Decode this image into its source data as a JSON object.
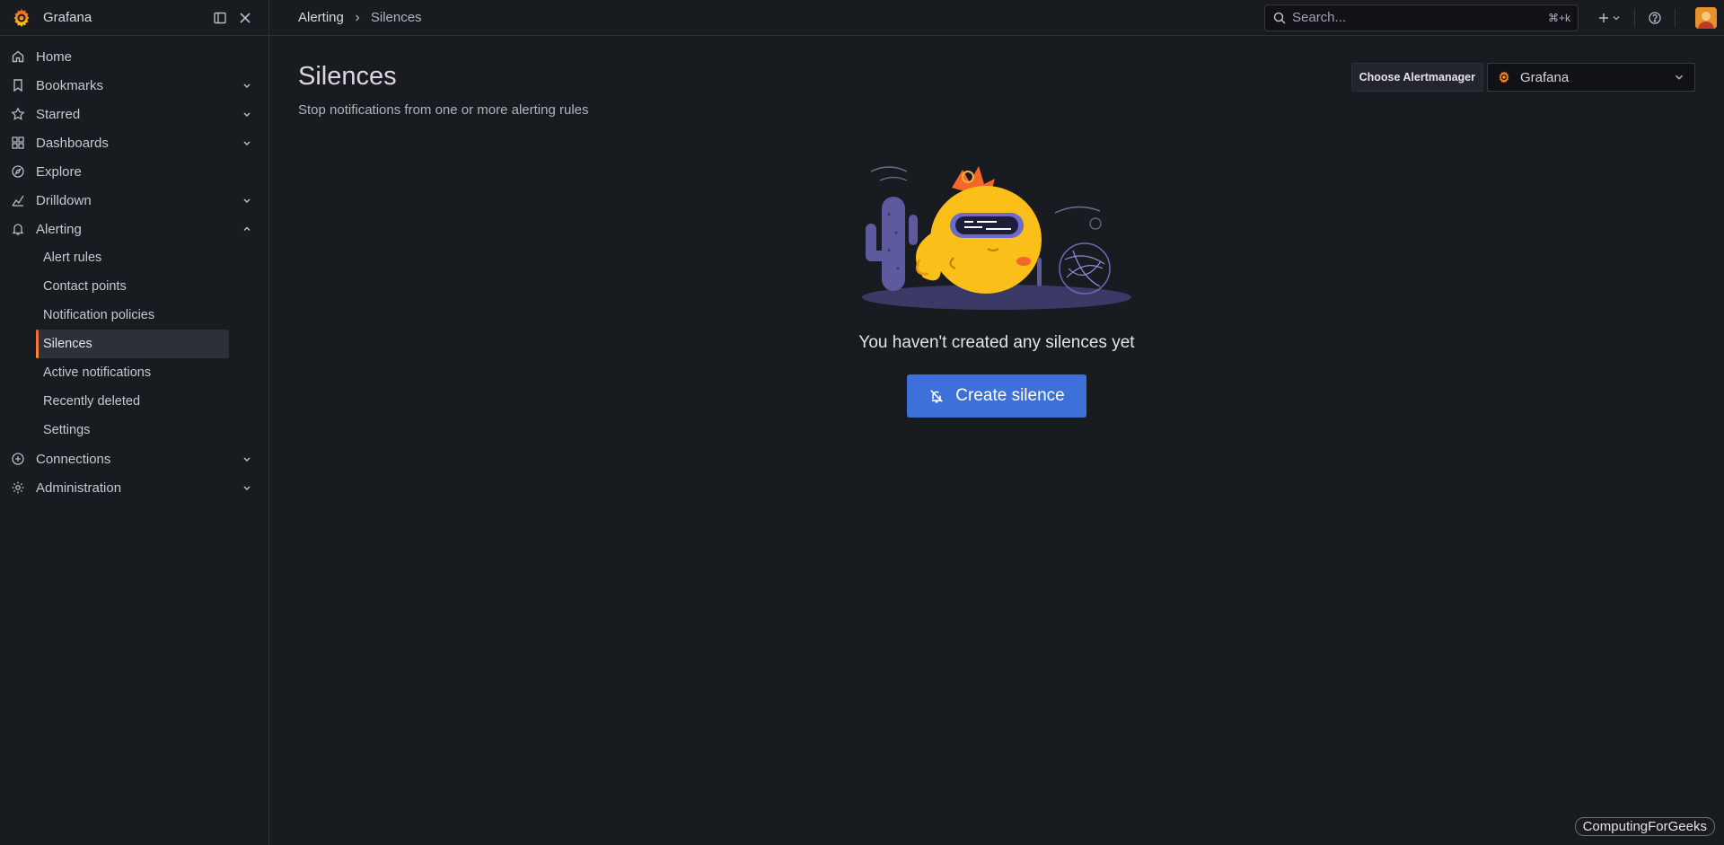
{
  "app": {
    "brand": "Grafana",
    "accent": "#f46800",
    "primary_button_color": "#3d71d9"
  },
  "sidebar": {
    "dock_icon": "dock-menu-icon",
    "close_icon": "close-icon",
    "items": [
      {
        "label": "Home",
        "icon": "home-icon",
        "expandable": false
      },
      {
        "label": "Bookmarks",
        "icon": "bookmark-icon",
        "expandable": true
      },
      {
        "label": "Starred",
        "icon": "star-icon",
        "expandable": true
      },
      {
        "label": "Dashboards",
        "icon": "apps-icon",
        "expandable": true
      },
      {
        "label": "Explore",
        "icon": "compass-icon",
        "expandable": false
      },
      {
        "label": "Drilldown",
        "icon": "drilldown-icon",
        "expandable": true
      },
      {
        "label": "Alerting",
        "icon": "bell-icon",
        "expandable": true,
        "expanded": true
      },
      {
        "label": "Connections",
        "icon": "connections-icon",
        "expandable": true
      },
      {
        "label": "Administration",
        "icon": "cog-icon",
        "expandable": true
      }
    ],
    "alerting_children": [
      {
        "label": "Alert rules"
      },
      {
        "label": "Contact points"
      },
      {
        "label": "Notification policies"
      },
      {
        "label": "Silences",
        "active": true
      },
      {
        "label": "Active notifications"
      },
      {
        "label": "Recently deleted"
      },
      {
        "label": "Settings"
      }
    ]
  },
  "topbar": {
    "breadcrumb": {
      "parent": "Alerting",
      "current": "Silences"
    },
    "search": {
      "placeholder": "Search...",
      "shortcut": "⌘+k"
    }
  },
  "page": {
    "title": "Silences",
    "subtitle": "Stop notifications from one or more alerting rules",
    "alertmanager": {
      "label": "Choose Alertmanager",
      "selected": "Grafana"
    },
    "empty_state": {
      "message": "You haven't created any silences yet",
      "button_label": "Create silence"
    }
  },
  "watermark": "ComputingForGeeks"
}
